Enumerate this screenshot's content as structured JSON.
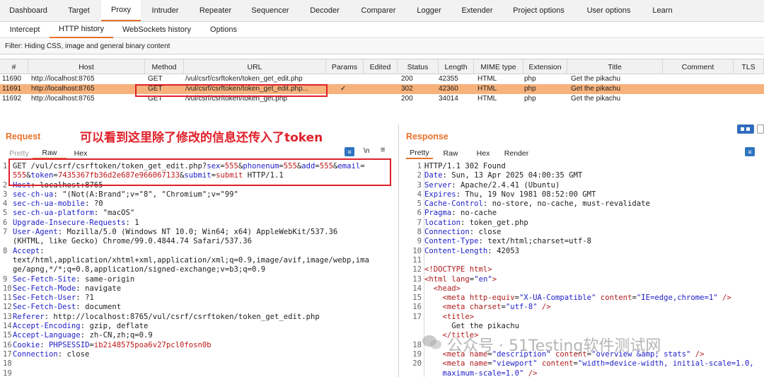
{
  "top_tabs": [
    "Dashboard",
    "Target",
    "Proxy",
    "Intruder",
    "Repeater",
    "Sequencer",
    "Decoder",
    "Comparer",
    "Logger",
    "Extender",
    "Project options",
    "User options",
    "Learn"
  ],
  "sub_tabs": [
    "Intercept",
    "HTTP history",
    "WebSockets history",
    "Options"
  ],
  "filter_text": "Filter: Hiding CSS, image and general binary content",
  "history": {
    "columns": [
      "#",
      "Host",
      "Method",
      "URL",
      "Params",
      "Edited",
      "Status",
      "Length",
      "MIME type",
      "Extension",
      "Title",
      "Comment",
      "TLS"
    ],
    "rows": [
      {
        "num": "11690",
        "host": "http://localhost:8765",
        "method": "GET",
        "url": "/vul/csrf/csrftoken/token_get_edit.php",
        "params": "",
        "status": "200",
        "length": "42355",
        "mime": "HTML",
        "ext": "php",
        "title": "Get the pikachu"
      },
      {
        "num": "11691",
        "host": "http://localhost:8765",
        "method": "GET",
        "url": "/vul/csrf/csrftoken/token_get_edit.php...",
        "params": "✓",
        "status": "302",
        "length": "42360",
        "mime": "HTML",
        "ext": "php",
        "title": "Get the pikachu"
      },
      {
        "num": "11692",
        "host": "http://localhost:8765",
        "method": "GET",
        "url": "/vul/csrf/csrftoken/token_get.php",
        "params": "",
        "status": "200",
        "length": "34014",
        "mime": "HTML",
        "ext": "php",
        "title": "Get the pikachu"
      }
    ]
  },
  "request": {
    "title": "Request",
    "annotation": "可以看到这里除了修改的信息还传入了token",
    "view_tabs": [
      "Pretty",
      "Raw",
      "Hex"
    ],
    "ln_label": "\\n",
    "line1a": "GET /vul/csrf/csrftoken/token_get_edit.php?",
    "p_sex_k": "sex",
    "p_sex_v": "555",
    "p_phone_k": "phonenum",
    "p_phone_v": "555",
    "p_add_k": "add",
    "p_add_v": "555",
    "p_email_k": "email",
    "p_email_v": "555",
    "p_token_k": "token",
    "p_token_v": "7435367fb36d2e687e966067133",
    "p_submit_k": "submit",
    "p_submit_v": "submit",
    "line1_end": " HTTP/1.1",
    "headers": [
      {
        "n": "2",
        "k": "Host",
        "v": " localhost:8765"
      },
      {
        "n": "3",
        "k": "sec-ch-ua",
        "v": " \"(Not(A:Brand\";v=\"8\", \"Chromium\";v=\"99\""
      },
      {
        "n": "4",
        "k": "sec-ch-ua-mobile",
        "v": " ?0"
      },
      {
        "n": "5",
        "k": "sec-ch-ua-platform",
        "v": " \"macOS\""
      },
      {
        "n": "6",
        "k": "Upgrade-Insecure-Requests",
        "v": " 1"
      },
      {
        "n": "7",
        "k": "User-Agent",
        "v": " Mozilla/5.0 (Windows NT 10.0; Win64; x64) AppleWebKit/537.36"
      }
    ],
    "ua_cont": "(KHTML, like Gecko) Chrome/99.0.4844.74 Safari/537.36",
    "accept_k": "Accept",
    "accept_v1": "text/html,application/xhtml+xml,application/xml;q=0.9,image/avif,image/webp,ima",
    "accept_v2": "ge/apng,*/*;q=0.8,application/signed-exchange;v=b3;q=0.9",
    "headers2": [
      {
        "n": "9",
        "k": "Sec-Fetch-Site",
        "v": " same-origin"
      },
      {
        "n": "10",
        "k": "Sec-Fetch-Mode",
        "v": " navigate"
      },
      {
        "n": "11",
        "k": "Sec-Fetch-User",
        "v": " ?1"
      },
      {
        "n": "12",
        "k": "Sec-Fetch-Dest",
        "v": " document"
      },
      {
        "n": "13",
        "k": "Referer",
        "v": " http://localhost:8765/vul/csrf/csrftoken/token_get_edit.php"
      },
      {
        "n": "14",
        "k": "Accept-Encoding",
        "v": " gzip, deflate"
      },
      {
        "n": "15",
        "k": "Accept-Language",
        "v": " zh-CN,zh;q=0.9"
      }
    ],
    "cookie_k": "Cookie",
    "cookie_name": "PHPSESSID",
    "cookie_val": "ib2i48575poa6v27pcl0fosn0b",
    "conn_k": "Connection",
    "conn_v": " close"
  },
  "response": {
    "title": "Response",
    "view_tabs": [
      "Pretty",
      "Raw",
      "Hex",
      "Render"
    ],
    "status_line": "HTTP/1.1 302 Found",
    "headers": [
      {
        "n": "2",
        "k": "Date",
        "v": " Sun, 13 Apr 2025 04:00:35 GMT"
      },
      {
        "n": "3",
        "k": "Server",
        "v": " Apache/2.4.41 (Ubuntu)"
      },
      {
        "n": "4",
        "k": "Expires",
        "v": " Thu, 19 Nov 1981 08:52:00 GMT"
      },
      {
        "n": "5",
        "k": "Cache-Control",
        "v": " no-store, no-cache, must-revalidate"
      },
      {
        "n": "6",
        "k": "Pragma",
        "v": " no-cache"
      },
      {
        "n": "7",
        "k": "location",
        "v": " token_get.php"
      },
      {
        "n": "8",
        "k": "Connection",
        "v": " close"
      },
      {
        "n": "9",
        "k": "Content-Type",
        "v": " text/html;charset=utf-8"
      },
      {
        "n": "10",
        "k": "Content-Length",
        "v": " 42053"
      }
    ],
    "doctype": "<!DOCTYPE html>",
    "html_open": "<html",
    "lang_attr": "lang",
    "lang_val": "\"en\"",
    "head": "<head>",
    "meta1_attr1": "http-equiv",
    "meta1_val1": "\"X-UA-Compatible\"",
    "meta1_attr2": "content",
    "meta1_val2": "\"IE=edge,chrome=1\"",
    "meta2_attr": "charset",
    "meta2_val": "\"utf-8\"",
    "title_open": "<title>",
    "title_text": "Get the pikachu",
    "title_close": "</title>",
    "meta3_attr1": "name",
    "meta3_val1": "\"description\"",
    "meta3_attr2": "content",
    "meta3_val2": "\"overview &amp; stats\"",
    "meta4_attr1": "name",
    "meta4_val1": "\"viewport\"",
    "meta4_attr2": "content",
    "meta4_val2a": "\"width=device-width, initial-scale=1.0,",
    "meta4_val2b": "maximum-scale=1.0\"",
    "meta_tag": "<meta",
    "end_slash": " />",
    "end_gt": ">"
  },
  "watermark": "公众号 · 51Testing软件测试网"
}
